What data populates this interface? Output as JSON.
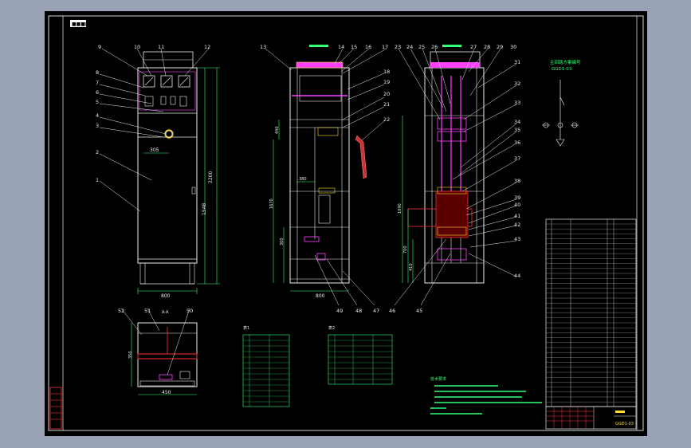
{
  "header_tag": "■■■■■",
  "callouts": {
    "front_view": [
      "1",
      "2",
      "3",
      "4",
      "5",
      "6",
      "7",
      "8",
      "9",
      "10",
      "11",
      "12"
    ],
    "side_view": [
      "13",
      "14",
      "15",
      "16",
      "17",
      "18",
      "19",
      "20",
      "21",
      "22",
      "47",
      "48",
      "49"
    ],
    "rear_view": [
      "23",
      "24",
      "25",
      "26",
      "27",
      "28",
      "29",
      "30",
      "31",
      "32",
      "33",
      "34",
      "35",
      "36",
      "37",
      "38",
      "39",
      "40",
      "41",
      "42",
      "43",
      "44",
      "45",
      "46"
    ],
    "top_view": [
      "50",
      "51",
      "52"
    ]
  },
  "dimensions": {
    "front_width": "800",
    "front_inner": "305",
    "front_height_a": "2200",
    "front_height_b": "1548",
    "side_width": "800",
    "side_h1": "440",
    "side_h2": "1670",
    "side_h3": "380",
    "side_h4": "300",
    "rear_h1": "1090",
    "rear_h2": "700",
    "rear_h3": "410",
    "top_width": "450",
    "top_depth": "350",
    "top_label": "A-A"
  },
  "schematic_title": [
    "主回路方案编号",
    "GGD1-03"
  ],
  "table1": {
    "title": "表1"
  },
  "table2": {
    "title": "表2"
  },
  "tech_notes_title": "技术要求",
  "title_block_label": "GGD1-03"
}
